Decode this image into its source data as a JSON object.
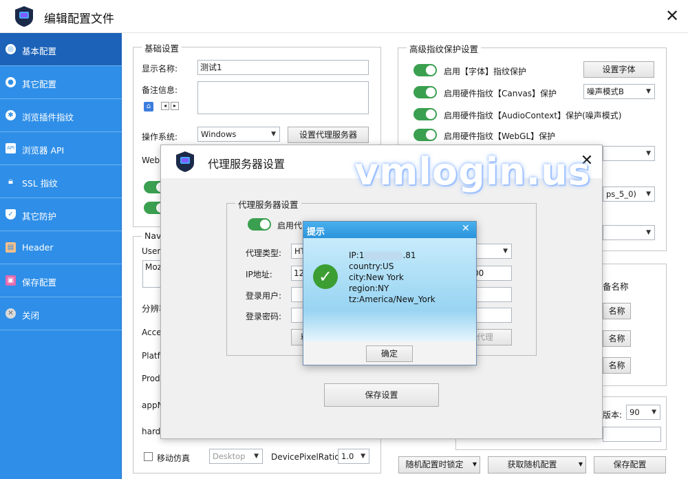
{
  "app": {
    "title": "编辑配置文件",
    "close_glyph": "✕"
  },
  "sidebar": {
    "items": [
      {
        "label": "基本配置",
        "icon": "compass-icon"
      },
      {
        "label": "其它配置",
        "icon": "chrome-icon"
      },
      {
        "label": "浏览插件指纹",
        "icon": "plugin-icon"
      },
      {
        "label": "浏览器 API",
        "icon": "api-icon"
      },
      {
        "label": "SSL 指纹",
        "icon": "lock-icon"
      },
      {
        "label": "其它防护",
        "icon": "shield-icon"
      },
      {
        "label": "Header",
        "icon": "header-icon"
      },
      {
        "label": "保存配置",
        "icon": "save-icon"
      },
      {
        "label": "关闭",
        "icon": "close-icon"
      }
    ]
  },
  "basic": {
    "group_title": "基础设置",
    "display_name_label": "显示名称:",
    "display_name_value": "测试1",
    "note_label": "备注信息:",
    "os_label": "操作系统:",
    "os_value": "Windows",
    "proxy_button": "设置代理服务器",
    "webrtc_label": "WebR"
  },
  "nav": {
    "group_title": "Nav",
    "user_agent_label": "User-",
    "user_agent_value": "Mozi",
    "resolution_label": "分辨率",
    "accept_label": "Accep",
    "platform_label": "Platfo",
    "product_label": "Produ",
    "appname_label": "appNa",
    "hardware_label": "hardw",
    "mobile_label": "移动仿真",
    "device_value": "Desktop",
    "dpr_label": "DevicePixelRatio:",
    "dpr_value": "1.0"
  },
  "advanced": {
    "group_title": "高级指纹保护设置",
    "font_protect": "启用【字体】指纹保护",
    "font_button": "设置字体",
    "canvas_protect": "启用硬件指纹【Canvas】保护",
    "canvas_mode": "噪声模式B",
    "audio_protect": "启用硬件指纹【AudioContext】保护(噪声模式)",
    "webgl_protect": "启用硬件指纹【WebGL】保护",
    "partial_select_value": "ps_5_0)",
    "device_name_label": "备名称",
    "name_btn_1": "名称",
    "name_btn_2": "名称",
    "name_btn_3": "名称",
    "version_label": "版本:",
    "version_value": "90"
  },
  "footer": {
    "random_lock": "随机配置时锁定",
    "get_random": "获取随机配置",
    "save": "保存配置"
  },
  "proxy_dialog": {
    "title": "代理服务器设置",
    "close_glyph": "✕",
    "group_title": "代理服务器设置",
    "enable_label": "启用代",
    "type_label": "代理类型:",
    "type_value": "HT",
    "ip_label": "IP地址:",
    "ip_value": "12",
    "port_value": "00",
    "user_label": "登录用户:",
    "pass_label": "登录密码:",
    "paste_button": "粘",
    "test_button": "试代理",
    "save_button": "保存设置"
  },
  "watermark": "vmlogin.us",
  "alert": {
    "title": "提示",
    "close_glyph": "✕",
    "ip_prefix": "IP:1",
    "ip_suffix": ".81",
    "country": "country:US",
    "city": "city:New York",
    "region": "region:NY",
    "tz": "tz:America/New_York",
    "ok_button": "确定"
  }
}
